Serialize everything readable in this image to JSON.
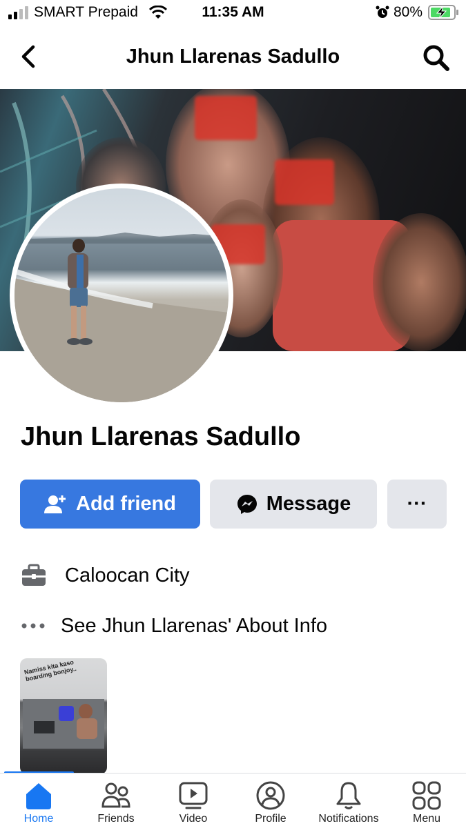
{
  "status_bar": {
    "carrier": "SMART Prepaid",
    "time": "11:35 AM",
    "battery_percent": "80%",
    "battery_level": 0.8
  },
  "header": {
    "title": "Jhun Llarenas Sadullo"
  },
  "profile": {
    "name": "Jhun Llarenas Sadullo"
  },
  "actions": {
    "add_friend": "Add friend",
    "message": "Message",
    "more": "···"
  },
  "info": {
    "work": "Caloocan City",
    "about": "See Jhun Llarenas' About Info"
  },
  "story": {
    "caption": "Namiss kita kaso boarding bonjoy.."
  },
  "tabs": [
    {
      "label": "Home",
      "icon": "home-icon",
      "active": true
    },
    {
      "label": "Friends",
      "icon": "friends-icon"
    },
    {
      "label": "Video",
      "icon": "video-icon"
    },
    {
      "label": "Profile",
      "icon": "profile-icon"
    },
    {
      "label": "Notifications",
      "icon": "bell-icon"
    },
    {
      "label": "Menu",
      "icon": "menu-grid-icon"
    }
  ],
  "colors": {
    "accent": "#1877f2",
    "add_button": "#3778e0",
    "secondary_button": "#e4e6eb"
  }
}
